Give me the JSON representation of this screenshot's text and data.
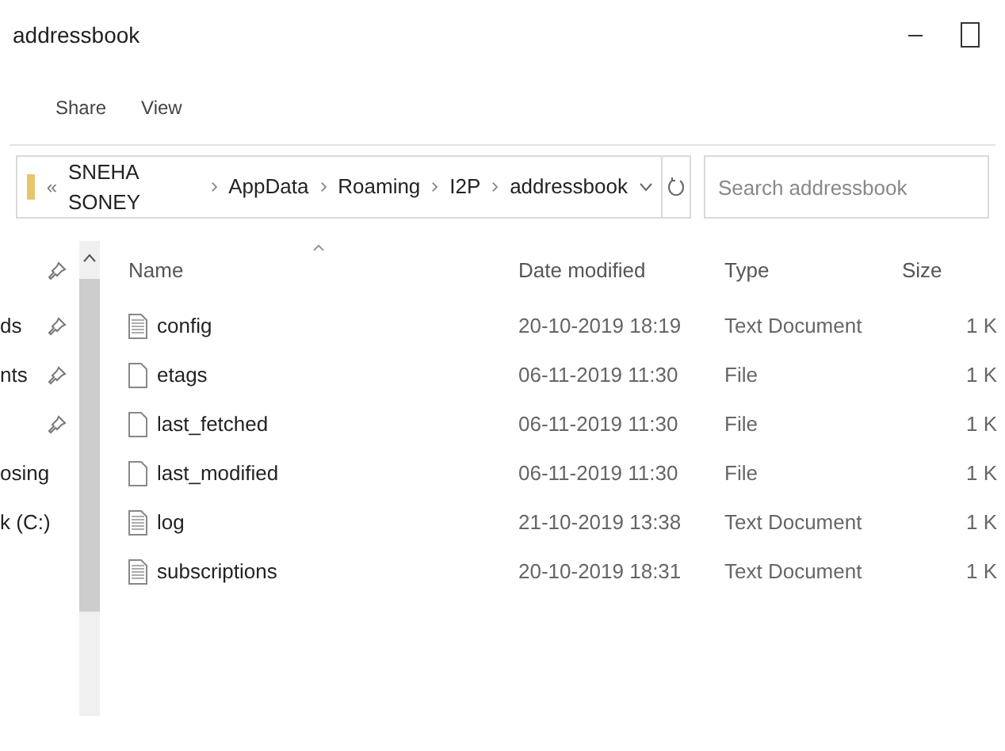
{
  "window": {
    "title": "addressbook"
  },
  "ribbon_tabs": [
    {
      "label": "Share",
      "selected": false
    },
    {
      "label": "View",
      "selected": false
    }
  ],
  "address_bar": {
    "path": [
      "SNEHA SONEY",
      "AppData",
      "Roaming",
      "I2P",
      "addressbook"
    ],
    "overflow": "«"
  },
  "search": {
    "placeholder": "Search addressbook"
  },
  "sidebar": {
    "items": [
      {
        "pinned": true
      },
      {
        "label": "ds",
        "pinned": true
      },
      {
        "label": "nts",
        "pinned": true
      },
      {
        "pinned": true
      },
      {
        "label": "osing",
        "pinned": false
      },
      {
        "label": "k (C:)",
        "pinned": false
      }
    ]
  },
  "table": {
    "columns": [
      "Name",
      "Date modified",
      "Type",
      "Size"
    ],
    "rows": [
      {
        "name": "config",
        "kind": "text",
        "date": "20-10-2019 18:19",
        "type": "Text Document",
        "size": "1 K"
      },
      {
        "name": "etags",
        "kind": "file",
        "date": "06-11-2019 11:30",
        "type": "File",
        "size": "1 K"
      },
      {
        "name": "last_fetched",
        "kind": "file",
        "date": "06-11-2019 11:30",
        "type": "File",
        "size": "1 K"
      },
      {
        "name": "last_modified",
        "kind": "file",
        "date": "06-11-2019 11:30",
        "type": "File",
        "size": "1 K"
      },
      {
        "name": "log",
        "kind": "text",
        "date": "21-10-2019 13:38",
        "type": "Text Document",
        "size": "1 K"
      },
      {
        "name": "subscriptions",
        "kind": "text",
        "date": "20-10-2019 18:31",
        "type": "Text Document",
        "size": "1 K"
      }
    ]
  }
}
